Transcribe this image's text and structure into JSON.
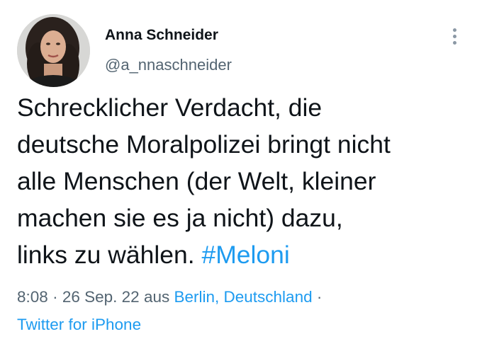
{
  "author": {
    "display_name": "Anna Schneider",
    "handle": "@a_nnaschneider"
  },
  "menu": {
    "icon": "more-vertical-icon"
  },
  "tweet": {
    "lines": [
      "Schrecklicher Verdacht, die",
      "deutsche Moralpolizei bringt nicht",
      "alle Menschen (der Welt, kleiner",
      "machen sie es ja nicht) dazu,",
      "links zu wählen."
    ],
    "hashtag": "#Meloni"
  },
  "meta": {
    "time": "8:08",
    "separator": "·",
    "date": "26 Sep. 22",
    "from_label": "aus",
    "location": "Berlin, Deutschland",
    "client": "Twitter for iPhone"
  },
  "colors": {
    "link": "#1d9bf0",
    "text": "#0f1419",
    "secondary": "#536471"
  }
}
